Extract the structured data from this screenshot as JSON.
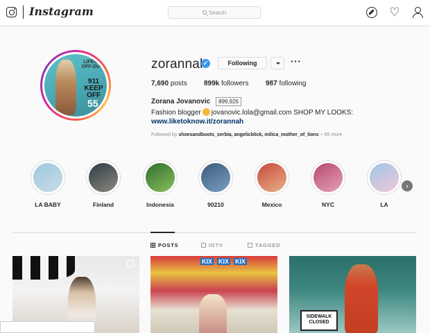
{
  "nav": {
    "wordmark": "Instagram",
    "search_placeholder": "Search",
    "icons": [
      "instagram-camera-icon",
      "compass-icon",
      "heart-icon",
      "person-icon"
    ]
  },
  "profile": {
    "username": "zorannah",
    "verified": true,
    "following_button": "Following",
    "more": "···",
    "stats": {
      "posts_count": "7,690",
      "posts_label": "posts",
      "followers_count": "899k",
      "followers_label": "followers",
      "following_count": "987",
      "following_label": "following"
    },
    "followers_tooltip": "899,926",
    "full_name": "Zorana Jovanovic",
    "bio_start": "Fashion blogger",
    "bio_end": "jovanovic.lola@gmail.com SHOP MY LOOKS:",
    "link": "www.liketoknow.it/zorannah",
    "followed_by_prefix": "Followed by",
    "followed_by_names": "shoesandboots_serbia, angelicblick, milica_mother_of_lions",
    "followed_by_more": "+ 85 more",
    "avatar_text": [
      "LIFEGU OFF-DUT",
      "911 KEEP OFF",
      "55"
    ]
  },
  "highlights": [
    {
      "label": "LA BABY",
      "colors": [
        "#9ec9e0",
        "#c7dbe6"
      ]
    },
    {
      "label": "Finland",
      "colors": [
        "#2c3a44",
        "#8d8a80"
      ]
    },
    {
      "label": "Indonesia",
      "colors": [
        "#2f6e2f",
        "#8bbf5e"
      ]
    },
    {
      "label": "90210",
      "colors": [
        "#3d5a7a",
        "#7aa0c4"
      ]
    },
    {
      "label": "Mexico",
      "colors": [
        "#c84a3b",
        "#e7b08a"
      ]
    },
    {
      "label": "NYC",
      "colors": [
        "#b64a6e",
        "#e5a2b8"
      ]
    },
    {
      "label": "LA",
      "colors": [
        "#9fc5e8",
        "#f1c8d7"
      ]
    }
  ],
  "tabs": {
    "posts": "POSTS",
    "igtv": "IGTV",
    "tagged": "TAGGED",
    "active": "POSTS"
  },
  "posts": [
    {
      "id": 1
    },
    {
      "id": 2,
      "labels": [
        "KIX",
        "KIX",
        "KIX"
      ]
    },
    {
      "id": 3,
      "sign": "SIDEWALK CLOSED"
    }
  ]
}
